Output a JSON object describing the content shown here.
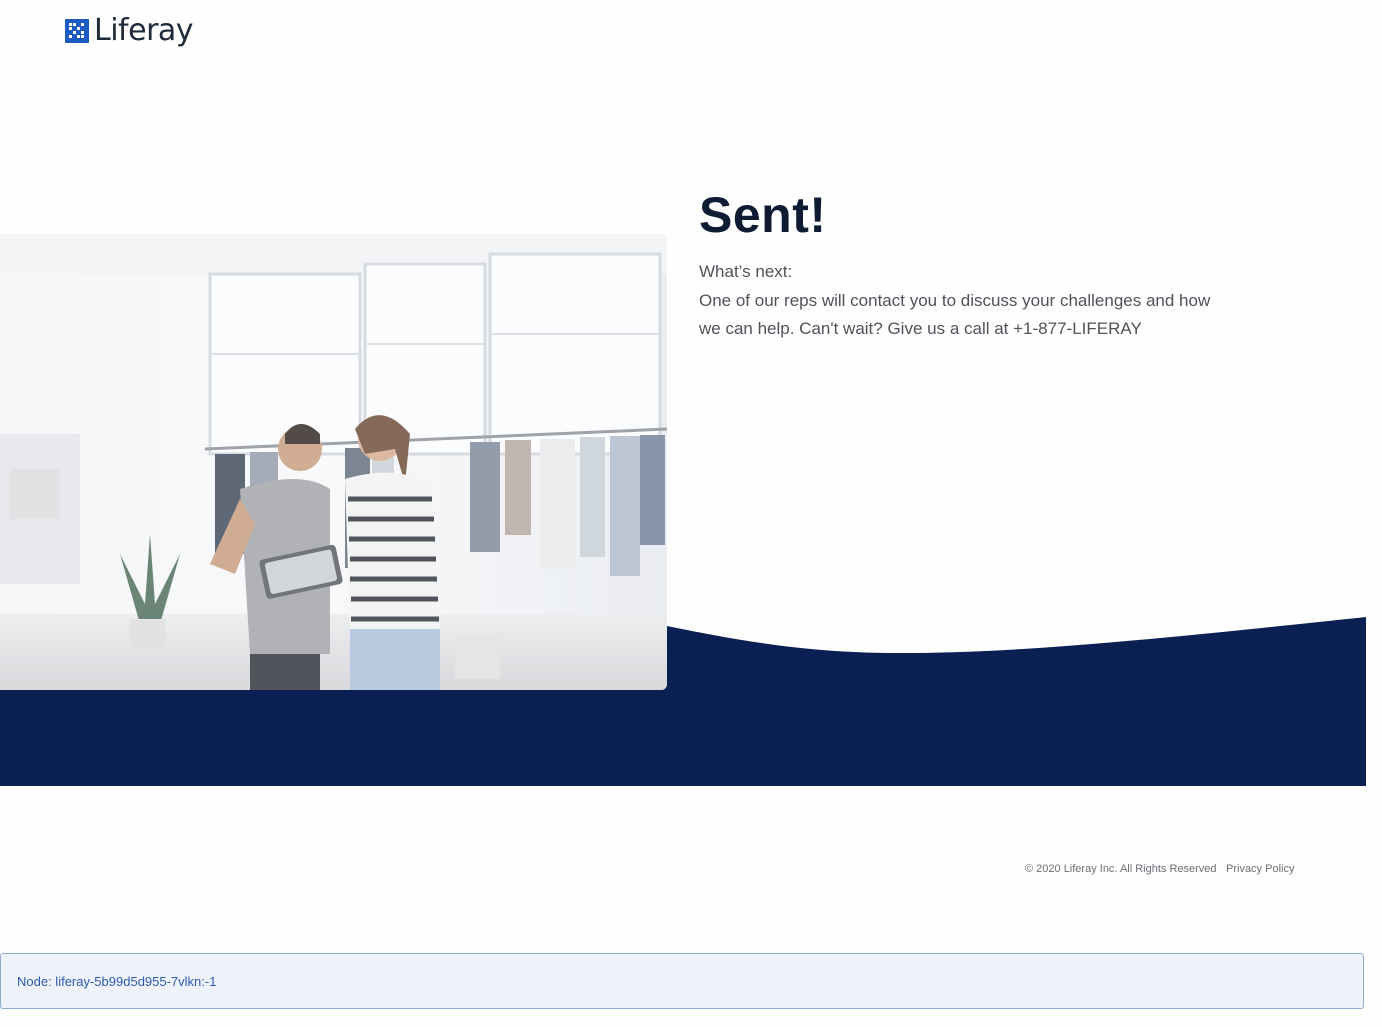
{
  "header": {
    "logo_text": "Liferay",
    "logo_icon": "liferay-logo-icon",
    "brand_color": "#1c5bc2"
  },
  "hero": {
    "image_description_icon": "photo-image",
    "title": "Sent!",
    "next_label": "What’s next:",
    "next_body": "One of our reps will contact you to discuss your challenges and how we can help. Can't wait? Give us a call at +1-877-LIFERAY"
  },
  "band": {
    "color": "#0a1f52"
  },
  "footer": {
    "copyright": "© 2020 Liferay Inc. All Rights Reserved",
    "privacy_link": "Privacy Policy"
  },
  "node_info": {
    "text": "Node: liferay-5b99d5d955-7vlkn:-1"
  }
}
